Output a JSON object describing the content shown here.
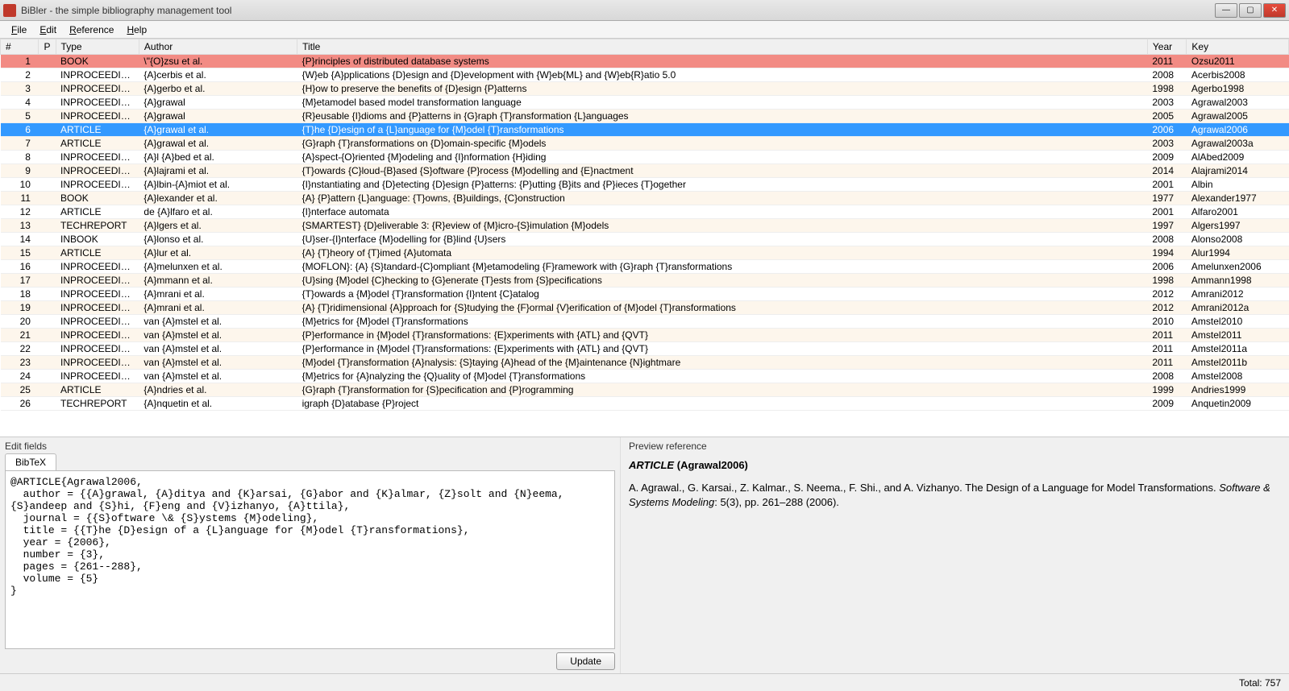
{
  "window": {
    "title": "BiBler - the simple bibliography management tool"
  },
  "menubar": [
    "File",
    "Edit",
    "Reference",
    "Help"
  ],
  "columns": {
    "num": "#",
    "p": "P",
    "type": "Type",
    "author": "Author",
    "title": "Title",
    "year": "Year",
    "key": "Key"
  },
  "rows": [
    {
      "n": 1,
      "type": "BOOK",
      "author": "\\\"{O}zsu et al.",
      "title": "{P}rinciples of distributed database systems",
      "year": 2011,
      "key": "Ozsu2011",
      "state": "invalid"
    },
    {
      "n": 2,
      "type": "INPROCEEDIN...",
      "author": "{A}cerbis et al.",
      "title": "{W}eb {A}pplications {D}esign and {D}evelopment with {W}eb{ML} and {W}eb{R}atio 5.0",
      "year": 2008,
      "key": "Acerbis2008"
    },
    {
      "n": 3,
      "type": "INPROCEEDIN...",
      "author": "{A}gerbo et al.",
      "title": "{H}ow to preserve the benefits of {D}esign {P}atterns",
      "year": 1998,
      "key": "Agerbo1998",
      "alt": true
    },
    {
      "n": 4,
      "type": "INPROCEEDIN...",
      "author": "{A}grawal",
      "title": "{M}etamodel based model transformation language",
      "year": 2003,
      "key": "Agrawal2003"
    },
    {
      "n": 5,
      "type": "INPROCEEDIN...",
      "author": "{A}grawal",
      "title": "{R}eusable {I}dioms and {P}atterns in {G}raph {T}ransformation {L}anguages",
      "year": 2005,
      "key": "Agrawal2005",
      "alt": true
    },
    {
      "n": 6,
      "type": "ARTICLE",
      "author": "{A}grawal et al.",
      "title": "{T}he {D}esign of a {L}anguage for {M}odel {T}ransformations",
      "year": 2006,
      "key": "Agrawal2006",
      "state": "selected"
    },
    {
      "n": 7,
      "type": "ARTICLE",
      "author": "{A}grawal et al.",
      "title": "{G}raph {T}ransformations on {D}omain-specific {M}odels",
      "year": 2003,
      "key": "Agrawal2003a",
      "alt": true
    },
    {
      "n": 8,
      "type": "INPROCEEDIN...",
      "author": "{A}l {A}bed et al.",
      "title": "{A}spect-{O}riented {M}odeling and {I}nformation {H}iding",
      "year": 2009,
      "key": "AlAbed2009"
    },
    {
      "n": 9,
      "type": "INPROCEEDIN...",
      "author": "{A}lajrami et al.",
      "title": "{T}owards {C}loud-{B}ased {S}oftware {P}rocess {M}odelling and {E}nactment",
      "year": 2014,
      "key": "Alajrami2014",
      "alt": true
    },
    {
      "n": 10,
      "type": "INPROCEEDIN...",
      "author": "{A}lbin-{A}miot et al.",
      "title": "{I}nstantiating and {D}etecting {D}esign {P}atterns: {P}utting {B}its and {P}ieces {T}ogether",
      "year": 2001,
      "key": "Albin"
    },
    {
      "n": 11,
      "type": "BOOK",
      "author": "{A}lexander et al.",
      "title": "{A} {P}attern {L}anguage: {T}owns, {B}uildings, {C}onstruction",
      "year": 1977,
      "key": "Alexander1977",
      "alt": true
    },
    {
      "n": 12,
      "type": "ARTICLE",
      "author": "de {A}lfaro et al.",
      "title": "{I}nterface automata",
      "year": 2001,
      "key": "Alfaro2001"
    },
    {
      "n": 13,
      "type": "TECHREPORT",
      "author": "{A}lgers et al.",
      "title": "{SMARTEST} {D}eliverable 3: {R}eview of {M}icro-{S}imulation {M}odels",
      "year": 1997,
      "key": "Algers1997",
      "alt": true
    },
    {
      "n": 14,
      "type": "INBOOK",
      "author": "{A}lonso et al.",
      "title": "{U}ser-{I}nterface {M}odelling for {B}lind {U}sers",
      "year": 2008,
      "key": "Alonso2008"
    },
    {
      "n": 15,
      "type": "ARTICLE",
      "author": "{A}lur et al.",
      "title": "{A} {T}heory of {T}imed {A}utomata",
      "year": 1994,
      "key": "Alur1994",
      "alt": true
    },
    {
      "n": 16,
      "type": "INPROCEEDIN...",
      "author": "{A}melunxen et al.",
      "title": "{MOFLON}: {A} {S}tandard-{C}ompliant {M}etamodeling {F}ramework with {G}raph {T}ransformations",
      "year": 2006,
      "key": "Amelunxen2006"
    },
    {
      "n": 17,
      "type": "INPROCEEDIN...",
      "author": "{A}mmann et al.",
      "title": "{U}sing {M}odel {C}hecking to {G}enerate {T}ests from {S}pecifications",
      "year": 1998,
      "key": "Ammann1998",
      "alt": true
    },
    {
      "n": 18,
      "type": "INPROCEEDIN...",
      "author": "{A}mrani et al.",
      "title": "{T}owards a {M}odel {T}ransformation {I}ntent {C}atalog",
      "year": 2012,
      "key": "Amrani2012"
    },
    {
      "n": 19,
      "type": "INPROCEEDIN...",
      "author": "{A}mrani et al.",
      "title": "{A} {T}ridimensional {A}pproach for {S}tudying the {F}ormal {V}erification of {M}odel {T}ransformations",
      "year": 2012,
      "key": "Amrani2012a",
      "alt": true
    },
    {
      "n": 20,
      "type": "INPROCEEDIN...",
      "author": "van {A}mstel et al.",
      "title": "{M}etrics for {M}odel {T}ransformations",
      "year": 2010,
      "key": "Amstel2010"
    },
    {
      "n": 21,
      "type": "INPROCEEDIN...",
      "author": "van {A}mstel et al.",
      "title": "{P}erformance in {M}odel {T}ransformations: {E}xperiments with {ATL} and {QVT}",
      "year": 2011,
      "key": "Amstel2011",
      "alt": true
    },
    {
      "n": 22,
      "type": "INPROCEEDIN...",
      "author": "van {A}mstel et al.",
      "title": "{P}erformance in {M}odel {T}ransformations: {E}xperiments with {ATL} and {QVT}",
      "year": 2011,
      "key": "Amstel2011a"
    },
    {
      "n": 23,
      "type": "INPROCEEDIN...",
      "author": "van {A}mstel et al.",
      "title": "{M}odel {T}ransformation {A}nalysis: {S}taying {A}head of the {M}aintenance {N}ightmare",
      "year": 2011,
      "key": "Amstel2011b",
      "alt": true
    },
    {
      "n": 24,
      "type": "INPROCEEDIN...",
      "author": "van {A}mstel et al.",
      "title": "{M}etrics for {A}nalyzing the {Q}uality of {M}odel {T}ransformations",
      "year": 2008,
      "key": "Amstel2008"
    },
    {
      "n": 25,
      "type": "ARTICLE",
      "author": "{A}ndries et al.",
      "title": "{G}raph {T}ransformation for {S}pecification and {P}rogramming",
      "year": 1999,
      "key": "Andries1999",
      "alt": true
    },
    {
      "n": 26,
      "type": "TECHREPORT",
      "author": "{A}nquetin et al.",
      "title": "igraph {D}atabase {P}roject",
      "year": 2009,
      "key": "Anquetin2009"
    }
  ],
  "edit": {
    "label": "Edit fields",
    "tab": "BibTeX",
    "bibtex": "@ARTICLE{Agrawal2006,\n  author = {{A}grawal, {A}ditya and {K}arsai, {G}abor and {K}almar, {Z}solt and {N}eema, {S}andeep and {S}hi, {F}eng and {V}izhanyo, {A}ttila},\n  journal = {{S}oftware \\& {S}ystems {M}odeling},\n  title = {{T}he {D}esign of a {L}anguage for {M}odel {T}ransformations},\n  year = {2006},\n  number = {3},\n  pages = {261--288},\n  volume = {5}\n}",
    "update": "Update"
  },
  "preview": {
    "label": "Preview reference",
    "title_type": "ARTICLE",
    "title_key": "(Agrawal2006)",
    "body_plain": "A. Agrawal., G. Karsai., Z. Kalmar., S. Neema., F. Shi., and A. Vizhanyo. The Design of a Language for Model Transformations. ",
    "journal": "Software & Systems Modeling",
    "tail": ": 5(3), pp. 261–288 (2006)."
  },
  "status": {
    "total_label": "Total: 757"
  }
}
